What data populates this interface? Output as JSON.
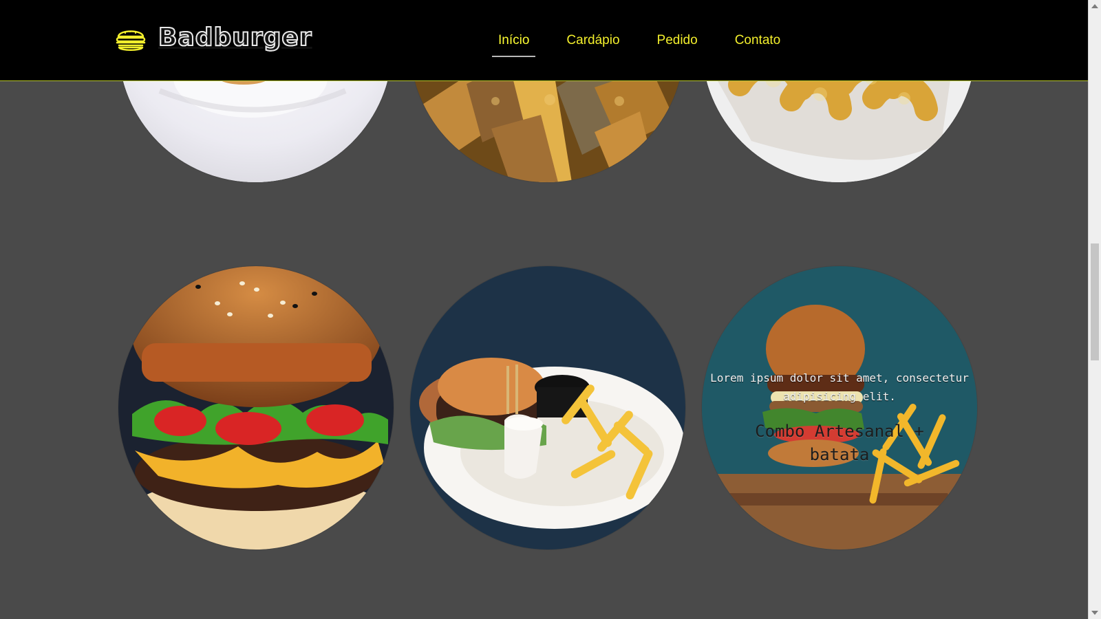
{
  "header": {
    "brand_name": "Badburger",
    "nav": [
      {
        "label": "Início"
      },
      {
        "label": "Cardápio"
      },
      {
        "label": "Pedido"
      },
      {
        "label": "Contato"
      }
    ]
  },
  "gallery": {
    "featured_item": {
      "description": "Lorem ipsum dolor sit amet, consectetur adipisicing elit.",
      "title": "Combo Artesanal + batata"
    }
  },
  "colors": {
    "header_bg": "#000000",
    "nav_text": "#f3ef2c",
    "active_underline": "#b9b9b9",
    "page_bg": "#4a4a4a",
    "accent_line": "#b7c72b"
  }
}
